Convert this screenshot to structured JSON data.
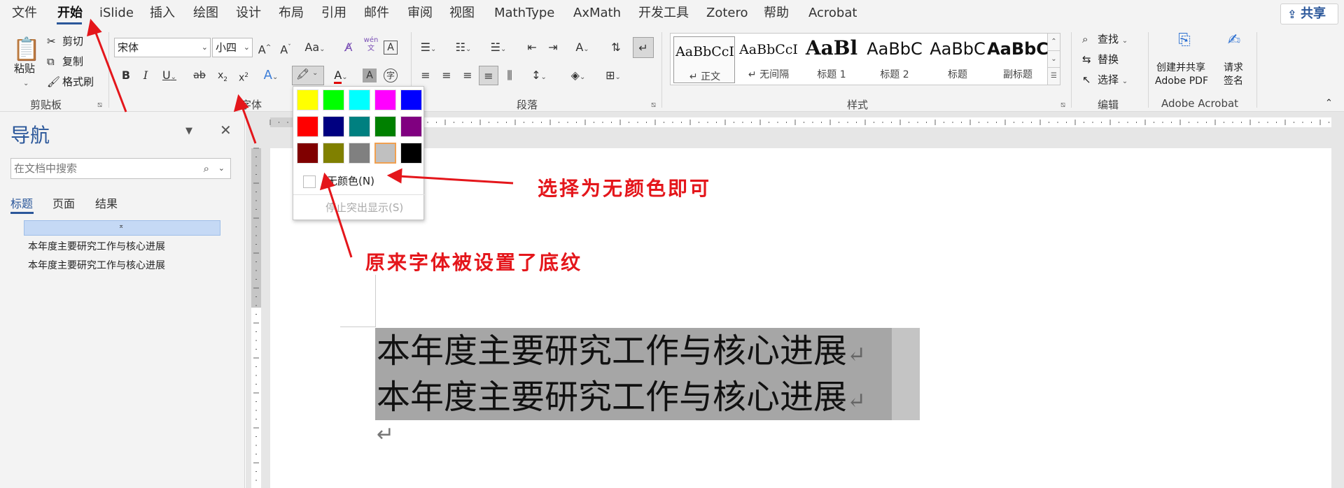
{
  "menu": {
    "tabs": [
      "文件",
      "开始",
      "iSlide",
      "插入",
      "绘图",
      "设计",
      "布局",
      "引用",
      "邮件",
      "审阅",
      "视图",
      "MathType",
      "AxMath",
      "开发工具",
      "Zotero",
      "帮助",
      "Acrobat"
    ],
    "active_tab": "开始",
    "share_label": "共享"
  },
  "clipboard": {
    "paste_label": "粘贴",
    "cut_label": "剪切",
    "copy_label": "复制",
    "format_painter_label": "格式刷",
    "group_label": "剪贴板"
  },
  "font": {
    "font_name": "宋体",
    "font_size": "小四",
    "group_label": "字体",
    "phonetic_label": "wén"
  },
  "paragraph": {
    "group_label": "段落"
  },
  "styles": {
    "items": [
      {
        "preview": "AaBbCcI",
        "label": "↵ 正文"
      },
      {
        "preview": "AaBbCcI",
        "label": "↵ 无间隔"
      },
      {
        "preview": "AaBl",
        "label": "标题 1"
      },
      {
        "preview": "AaBbC",
        "label": "标题 2"
      },
      {
        "preview": "AaBbC",
        "label": "标题"
      },
      {
        "preview": "AaBbC",
        "label": "副标题"
      }
    ],
    "group_label": "样式"
  },
  "editing": {
    "find_label": "查找",
    "replace_label": "替换",
    "select_label": "选择",
    "group_label": "编辑"
  },
  "acrobat": {
    "create_pdf_line1": "创建并共享",
    "create_pdf_line2": "Adobe PDF",
    "request_sign_line1": "请求",
    "request_sign_line2": "签名",
    "group_label": "Adobe Acrobat"
  },
  "nav": {
    "title": "导航",
    "search_placeholder": "在文档中搜索",
    "tabs": [
      "标题",
      "页面",
      "结果"
    ],
    "headings": [
      "本年度主要研究工作与核心进展",
      "本年度主要研究工作与核心进展"
    ]
  },
  "highlight_popup": {
    "colors": [
      "#ffff00",
      "#00ff00",
      "#00ffff",
      "#ff00ff",
      "#0000ff",
      "#ff0000",
      "#000080",
      "#008080",
      "#008000",
      "#800080",
      "#800000",
      "#808000",
      "#808080",
      "#c0c0c0",
      "#000000"
    ],
    "selected_color": "#c0c0c0",
    "no_color_label": "无颜色(N)",
    "stop_highlight_label": "停止突出显示(S)"
  },
  "document": {
    "lines": [
      "本年度主要研究工作与核心进展",
      "本年度主要研究工作与核心进展"
    ],
    "paragraph_mark": "↵",
    "shading_color": "#a6a6a6"
  },
  "annotations": {
    "note1": "选择为无颜色即可",
    "note2": "原来字体被设置了底纹",
    "arrow_color": "#e4161b"
  }
}
